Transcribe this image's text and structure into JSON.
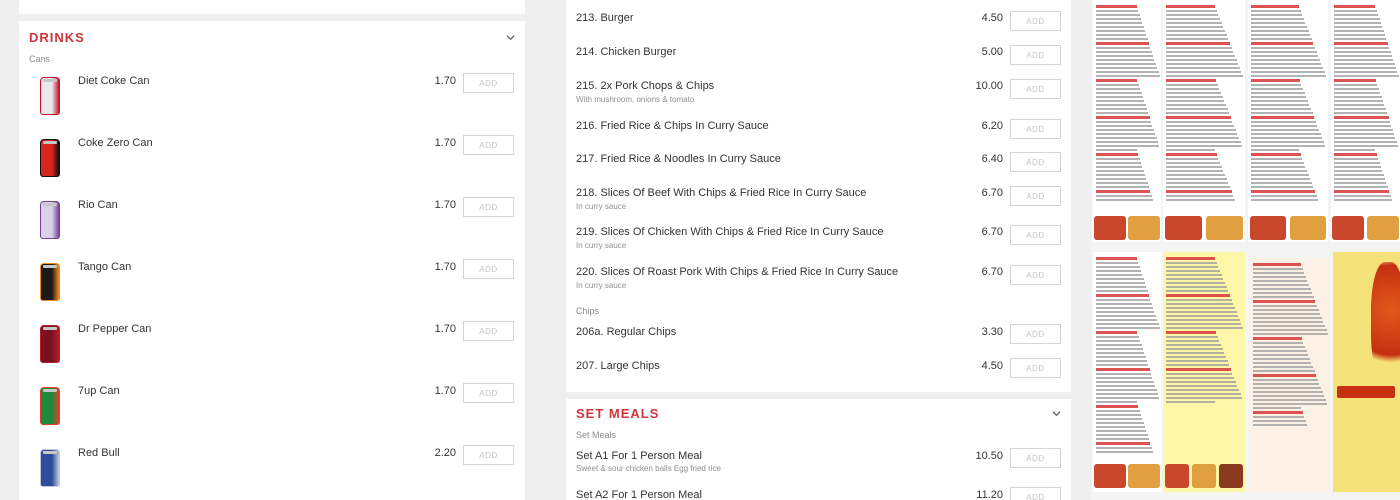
{
  "drinks": {
    "title": "DRINKS",
    "subcategory": "Cans",
    "add_label": "ADD",
    "items": [
      {
        "name": "Diet Coke Can",
        "price": "1.70",
        "can_color": "#e9e9e9",
        "accent": "#c8102e"
      },
      {
        "name": "Coke Zero Can",
        "price": "1.70",
        "can_color": "#d7261e",
        "accent": "#111111"
      },
      {
        "name": "Rio Can",
        "price": "1.70",
        "can_color": "#d9d2e8",
        "accent": "#7a3d9a"
      },
      {
        "name": "Tango Can",
        "price": "1.70",
        "can_color": "#1a1a1a",
        "accent": "#f28a1a"
      },
      {
        "name": "Dr Pepper Can",
        "price": "1.70",
        "can_color": "#7a1020",
        "accent": "#b51f2f"
      },
      {
        "name": "7up Can",
        "price": "1.70",
        "can_color": "#1c8a3a",
        "accent": "#e33d2f"
      },
      {
        "name": "Red Bull",
        "price": "2.20",
        "can_color": "#2d4d9a",
        "accent": "#c0c8d8"
      }
    ]
  },
  "mains": {
    "items": [
      {
        "name": "213. Burger",
        "desc": "",
        "price": "4.50"
      },
      {
        "name": "214. Chicken Burger",
        "desc": "",
        "price": "5.00"
      },
      {
        "name": "215. 2x Pork Chops & Chips",
        "desc": "With mushroom, onions & tomato",
        "price": "10.00"
      },
      {
        "name": "216. Fried Rice & Chips In Curry Sauce",
        "desc": "",
        "price": "6.20"
      },
      {
        "name": "217. Fried Rice & Noodles In Curry Sauce",
        "desc": "",
        "price": "6.40"
      },
      {
        "name": "218. Slices Of Beef With Chips & Fried Rice In Curry Sauce",
        "desc": "In curry sauce",
        "price": "6.70"
      },
      {
        "name": "219. Slices Of Chicken With Chips & Fried Rice In Curry Sauce",
        "desc": "In curry sauce",
        "price": "6.70"
      },
      {
        "name": "220. Slices Of Roast Pork With Chips & Fried Rice In Curry Sauce",
        "desc": "In curry sauce",
        "price": "6.70"
      }
    ],
    "chips_subcategory": "Chips",
    "chips": [
      {
        "name": "206a. Regular Chips",
        "price": "3.30"
      },
      {
        "name": "207. Large Chips",
        "price": "4.50"
      }
    ]
  },
  "set_meals": {
    "title": "SET MEALS",
    "subcategory": "Set Meals",
    "items": [
      {
        "name": "Set A1 For 1 Person Meal",
        "desc": "Sweet & sour chicken balls Egg fried rice",
        "price": "10.50"
      },
      {
        "name": "Set A2 For 1 Person Meal",
        "desc": "",
        "price": "11.20"
      }
    ]
  },
  "theme": {
    "accent": "#d0343a"
  }
}
